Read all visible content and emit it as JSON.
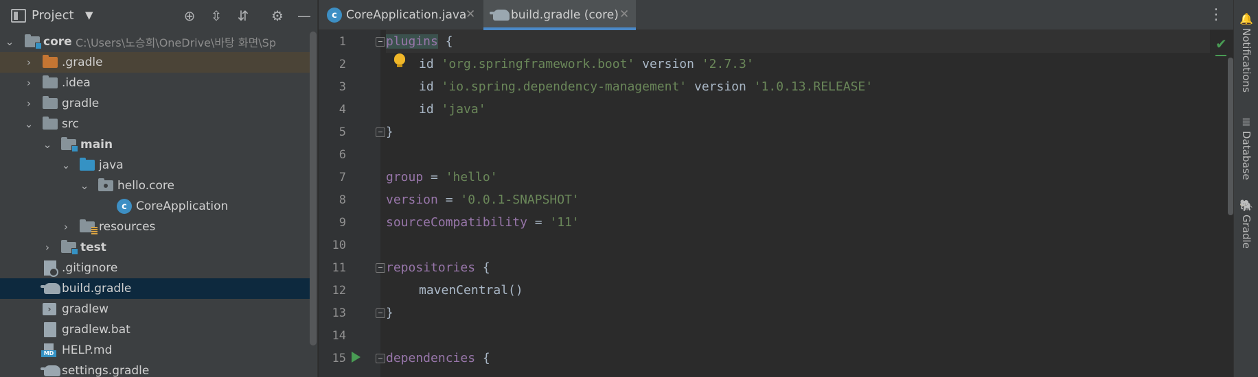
{
  "project_panel": {
    "title": "Project",
    "dropdown_glyph": "▼",
    "toolbar": [
      {
        "name": "locate-icon",
        "glyph": "⊕"
      },
      {
        "name": "expand-all-icon",
        "glyph": "⇳"
      },
      {
        "name": "collapse-all-icon",
        "glyph": "⇵"
      },
      {
        "name": "gear-icon",
        "glyph": "⚙"
      },
      {
        "name": "hide-icon",
        "glyph": "—"
      }
    ],
    "root": {
      "name": "core",
      "path": "C:\\Users\\노승희\\OneDrive\\바탕 화면\\Sp"
    },
    "items": [
      {
        "label": ".gradle"
      },
      {
        "label": ".idea"
      },
      {
        "label": "gradle"
      },
      {
        "label": "src"
      },
      {
        "label": "main"
      },
      {
        "label": "java"
      },
      {
        "label": "hello.core"
      },
      {
        "label": "CoreApplication"
      },
      {
        "label": "resources"
      },
      {
        "label": "test"
      },
      {
        "label": ".gitignore"
      },
      {
        "label": "build.gradle"
      },
      {
        "label": "gradlew"
      },
      {
        "label": "gradlew.bat"
      },
      {
        "label": "HELP.md"
      },
      {
        "label": "settings.gradle"
      }
    ]
  },
  "editor": {
    "tabs": [
      {
        "label": "CoreApplication.java",
        "active": false,
        "icon": "java-class-icon"
      },
      {
        "label": "build.gradle (core)",
        "active": true,
        "icon": "gradle-elephant-icon"
      }
    ],
    "tab_close_glyph": "✕",
    "menu_glyph": "⋮",
    "line_numbers": [
      "1",
      "2",
      "3",
      "4",
      "5",
      "6",
      "7",
      "8",
      "9",
      "10",
      "11",
      "12",
      "13",
      "14",
      "15"
    ],
    "code": {
      "l1": {
        "kw": "plugins",
        "rest": " {"
      },
      "l2": {
        "a": "id ",
        "s1": "'org.springframework.boot'",
        "b": " version ",
        "s2": "'2.7.3'"
      },
      "l3": {
        "a": "id ",
        "s1": "'io.spring.dependency-management'",
        "b": " version ",
        "s2": "'1.0.13.RELEASE'"
      },
      "l4": {
        "a": "id ",
        "s1": "'java'"
      },
      "l5": {
        "rest": "}"
      },
      "l7": {
        "kw": "group",
        "b": " = ",
        "s": "'hello'"
      },
      "l8": {
        "kw": "version",
        "b": " = ",
        "s": "'0.0.1-SNAPSHOT'"
      },
      "l9": {
        "kw": "sourceCompatibility",
        "b": " = ",
        "s": "'11'"
      },
      "l11": {
        "kw": "repositories",
        "rest": " {"
      },
      "l12": {
        "rest": "mavenCentral()"
      },
      "l13": {
        "rest": "}"
      },
      "l15": {
        "kw": "dependencies",
        "rest": " {"
      }
    },
    "inspection_glyph": "✔"
  },
  "right_strip": [
    {
      "label": "Notifications",
      "icon": "bell-icon",
      "glyph": "🔔"
    },
    {
      "label": "Database",
      "icon": "database-icon",
      "glyph": "≣"
    },
    {
      "label": "Gradle",
      "icon": "gradle-elephant-icon",
      "glyph": "🐘"
    }
  ],
  "colors": {
    "keyword": "#9876aa",
    "string": "#6a8759",
    "selection": "#0d293e",
    "active_tab_underline": "#4a88c7",
    "run_green": "#499c54"
  }
}
